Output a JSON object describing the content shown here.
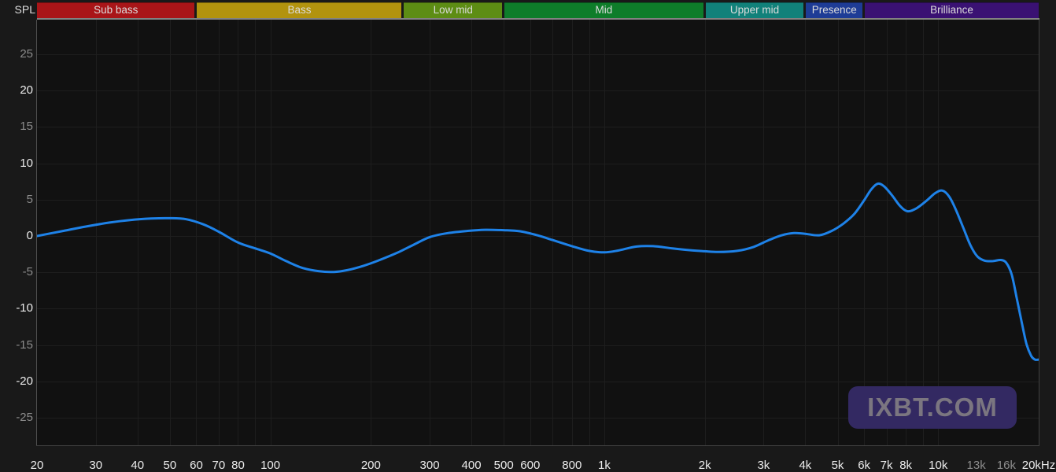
{
  "title": {
    "spl_label": "SPL"
  },
  "bands": [
    {
      "label": "Sub bass",
      "from_hz": 20,
      "to_hz": 60,
      "color": "#a91518"
    },
    {
      "label": "Bass",
      "from_hz": 60,
      "to_hz": 250,
      "color": "#b2930e"
    },
    {
      "label": "Low mid",
      "from_hz": 250,
      "to_hz": 500,
      "color": "#5d8d14"
    },
    {
      "label": "Mid",
      "from_hz": 500,
      "to_hz": 2000,
      "color": "#0e7d2a"
    },
    {
      "label": "Upper mid",
      "from_hz": 2000,
      "to_hz": 4000,
      "color": "#11817a"
    },
    {
      "label": "Presence",
      "from_hz": 4000,
      "to_hz": 6000,
      "color": "#1e3c96"
    },
    {
      "label": "Brilliance",
      "from_hz": 6000,
      "to_hz": 20000,
      "color": "#3a1173"
    }
  ],
  "chart_data": {
    "type": "line",
    "title": "",
    "x_scale": "log",
    "x_unit": "Hz",
    "y_unit": "dB SPL",
    "x_range": [
      20,
      20000
    ],
    "y_visible_range": [
      -28.8,
      30
    ],
    "grid": "on",
    "grid_color": "#1e1e1e",
    "y_ticks": [
      {
        "label": "25",
        "value": 25,
        "dim": true
      },
      {
        "label": "20",
        "value": 20,
        "dim": false
      },
      {
        "label": "15",
        "value": 15,
        "dim": true
      },
      {
        "label": "10",
        "value": 10,
        "dim": false
      },
      {
        "label": "5",
        "value": 5,
        "dim": true
      },
      {
        "label": "0",
        "value": 0,
        "dim": false
      },
      {
        "label": "-5",
        "value": -5,
        "dim": true
      },
      {
        "label": "-10",
        "value": -10,
        "dim": false
      },
      {
        "label": "-15",
        "value": -15,
        "dim": true
      },
      {
        "label": "-20",
        "value": -20,
        "dim": false
      },
      {
        "label": "-25",
        "value": -25,
        "dim": true
      }
    ],
    "x_ticks": [
      {
        "label": "20",
        "hz": 20,
        "dim": false
      },
      {
        "label": "30",
        "hz": 30,
        "dim": false
      },
      {
        "label": "40",
        "hz": 40,
        "dim": false
      },
      {
        "label": "50",
        "hz": 50,
        "dim": false
      },
      {
        "label": "60",
        "hz": 60,
        "dim": false
      },
      {
        "label": "70",
        "hz": 70,
        "dim": false
      },
      {
        "label": "80",
        "hz": 80,
        "dim": false
      },
      {
        "label": "100",
        "hz": 100,
        "dim": false
      },
      {
        "label": "200",
        "hz": 200,
        "dim": false
      },
      {
        "label": "300",
        "hz": 300,
        "dim": false
      },
      {
        "label": "400",
        "hz": 400,
        "dim": false
      },
      {
        "label": "500",
        "hz": 500,
        "dim": false
      },
      {
        "label": "600",
        "hz": 600,
        "dim": false
      },
      {
        "label": "800",
        "hz": 800,
        "dim": false
      },
      {
        "label": "1k",
        "hz": 1000,
        "dim": false
      },
      {
        "label": "2k",
        "hz": 2000,
        "dim": false
      },
      {
        "label": "3k",
        "hz": 3000,
        "dim": false
      },
      {
        "label": "4k",
        "hz": 4000,
        "dim": false
      },
      {
        "label": "5k",
        "hz": 5000,
        "dim": false
      },
      {
        "label": "6k",
        "hz": 6000,
        "dim": false
      },
      {
        "label": "7k",
        "hz": 7000,
        "dim": false
      },
      {
        "label": "8k",
        "hz": 8000,
        "dim": false
      },
      {
        "label": "10k",
        "hz": 10000,
        "dim": false
      },
      {
        "label": "13k",
        "hz": 13000,
        "dim": true
      },
      {
        "label": "16k",
        "hz": 16000,
        "dim": true
      },
      {
        "label": "20kHz",
        "hz": 20000,
        "dim": false
      }
    ],
    "series": [
      {
        "name": "frequency-response",
        "color": "#1e82e8",
        "points_hz_db": [
          [
            20,
            0.0
          ],
          [
            24,
            0.7
          ],
          [
            28,
            1.3
          ],
          [
            33,
            1.85
          ],
          [
            38,
            2.2
          ],
          [
            44,
            2.4
          ],
          [
            50,
            2.45
          ],
          [
            56,
            2.3
          ],
          [
            63,
            1.6
          ],
          [
            70,
            0.6
          ],
          [
            80,
            -0.9
          ],
          [
            90,
            -1.7
          ],
          [
            100,
            -2.4
          ],
          [
            112,
            -3.5
          ],
          [
            125,
            -4.4
          ],
          [
            140,
            -4.85
          ],
          [
            155,
            -4.95
          ],
          [
            170,
            -4.7
          ],
          [
            190,
            -4.1
          ],
          [
            210,
            -3.4
          ],
          [
            240,
            -2.3
          ],
          [
            270,
            -1.15
          ],
          [
            300,
            -0.15
          ],
          [
            340,
            0.4
          ],
          [
            390,
            0.7
          ],
          [
            440,
            0.85
          ],
          [
            500,
            0.8
          ],
          [
            560,
            0.65
          ],
          [
            630,
            0.1
          ],
          [
            700,
            -0.55
          ],
          [
            800,
            -1.4
          ],
          [
            900,
            -2.05
          ],
          [
            1000,
            -2.25
          ],
          [
            1100,
            -2.0
          ],
          [
            1250,
            -1.45
          ],
          [
            1400,
            -1.4
          ],
          [
            1600,
            -1.7
          ],
          [
            1800,
            -1.95
          ],
          [
            2000,
            -2.1
          ],
          [
            2200,
            -2.2
          ],
          [
            2500,
            -2.05
          ],
          [
            2800,
            -1.5
          ],
          [
            3100,
            -0.6
          ],
          [
            3400,
            0.1
          ],
          [
            3700,
            0.4
          ],
          [
            4000,
            0.3
          ],
          [
            4400,
            0.1
          ],
          [
            4800,
            0.7
          ],
          [
            5200,
            1.7
          ],
          [
            5600,
            3.0
          ],
          [
            6000,
            4.9
          ],
          [
            6300,
            6.4
          ],
          [
            6600,
            7.2
          ],
          [
            6900,
            6.8
          ],
          [
            7300,
            5.5
          ],
          [
            7700,
            4.1
          ],
          [
            8100,
            3.4
          ],
          [
            8600,
            3.8
          ],
          [
            9200,
            4.8
          ],
          [
            9800,
            5.9
          ],
          [
            10300,
            6.25
          ],
          [
            10800,
            5.4
          ],
          [
            11300,
            3.6
          ],
          [
            11900,
            1.1
          ],
          [
            12500,
            -1.3
          ],
          [
            13100,
            -2.8
          ],
          [
            13800,
            -3.4
          ],
          [
            14600,
            -3.45
          ],
          [
            15400,
            -3.3
          ],
          [
            16000,
            -3.7
          ],
          [
            16600,
            -5.3
          ],
          [
            17200,
            -8.6
          ],
          [
            17800,
            -11.9
          ],
          [
            18400,
            -14.9
          ],
          [
            19000,
            -16.5
          ],
          [
            19500,
            -17.0
          ],
          [
            20000,
            -17.0
          ]
        ]
      }
    ]
  },
  "watermark": {
    "text": "IXBT.COM",
    "bg_color": "#332962",
    "text_color": "#7b7680"
  }
}
